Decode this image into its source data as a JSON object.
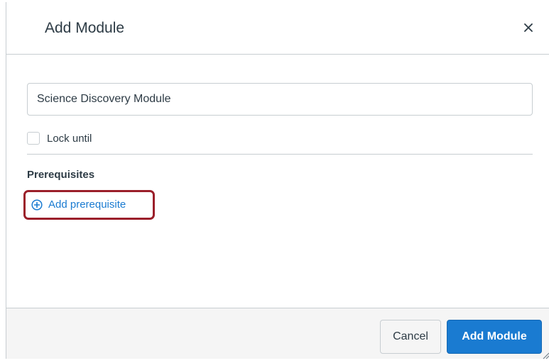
{
  "dialog": {
    "title": "Add Module",
    "close_icon": "close-icon"
  },
  "form": {
    "module_name_value": "Science Discovery Module",
    "lock_until_label": "Lock until",
    "lock_until_checked": false,
    "prerequisites_heading": "Prerequisites",
    "add_prerequisite_label": "Add prerequisite",
    "add_prerequisite_icon": "plus-circle-icon"
  },
  "footer": {
    "cancel_label": "Cancel",
    "submit_label": "Add Module"
  },
  "colors": {
    "link_blue": "#1a7bd1",
    "primary_button": "#1a7bd1",
    "highlight_border": "#9b1f2a",
    "text": "#2d3b45",
    "border": "#c7cdd1",
    "footer_bg": "#f5f5f5"
  }
}
